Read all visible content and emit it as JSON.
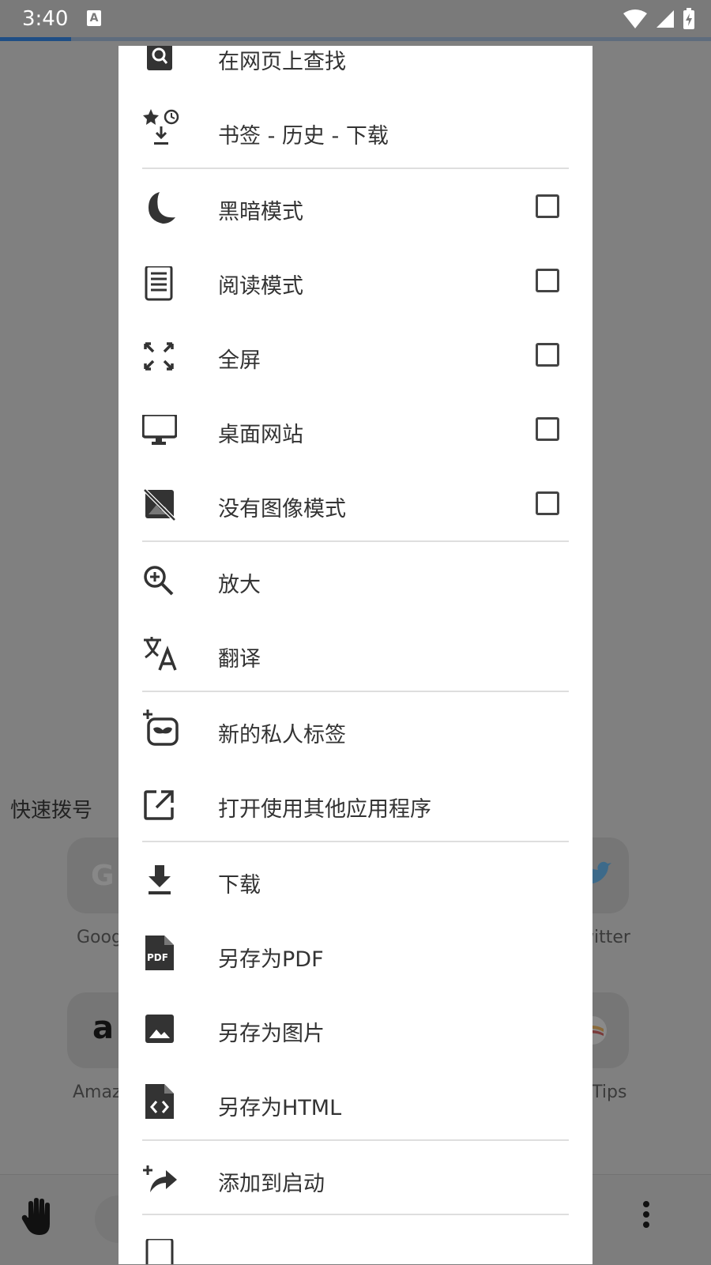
{
  "status_bar": {
    "time": "3:40",
    "notification_icon": "a-text-icon",
    "icons": [
      "wifi-icon",
      "cell-signal-icon",
      "battery-charging-icon"
    ],
    "page_load_progress": 0.1
  },
  "background_page": {
    "section_title": "快速拨号",
    "tiles": [
      {
        "label": "Goog",
        "icon": "google-icon"
      },
      {
        "label": "witter",
        "icon": "twitter-icon"
      },
      {
        "label": "Amaz",
        "icon": "amazon-icon"
      },
      {
        "label": "l Tips",
        "icon": "tips-icon"
      }
    ],
    "bottom_bar": {
      "left_icon": "hand-icon",
      "right_icon": "overflow-icon"
    }
  },
  "menu": {
    "items": [
      {
        "label": "在网页上查找",
        "icon": "find-in-page-icon"
      },
      {
        "label": "书签 - 历史 - 下载",
        "icon": "bookmarks-history-icon"
      },
      {
        "label": "黑暗模式",
        "icon": "moon-icon",
        "checkbox": false
      },
      {
        "label": "阅读模式",
        "icon": "reader-icon",
        "checkbox": false
      },
      {
        "label": "全屏",
        "icon": "fullscreen-icon",
        "checkbox": false
      },
      {
        "label": "桌面网站",
        "icon": "desktop-icon",
        "checkbox": false
      },
      {
        "label": "没有图像模式",
        "icon": "no-image-icon",
        "checkbox": false
      },
      {
        "label": "放大",
        "icon": "zoom-in-icon"
      },
      {
        "label": "翻译",
        "icon": "translate-icon"
      },
      {
        "label": "新的私人标签",
        "icon": "private-tab-icon"
      },
      {
        "label": "打开使用其他应用程序",
        "icon": "open-external-icon"
      },
      {
        "label": "下载",
        "icon": "download-icon"
      },
      {
        "label": "另存为PDF",
        "icon": "pdf-icon"
      },
      {
        "label": "另存为图片",
        "icon": "image-icon"
      },
      {
        "label": "另存为HTML",
        "icon": "html-file-icon"
      },
      {
        "label": "添加到启动",
        "icon": "add-to-launch-icon"
      }
    ],
    "pdf_badge": "PDF"
  }
}
